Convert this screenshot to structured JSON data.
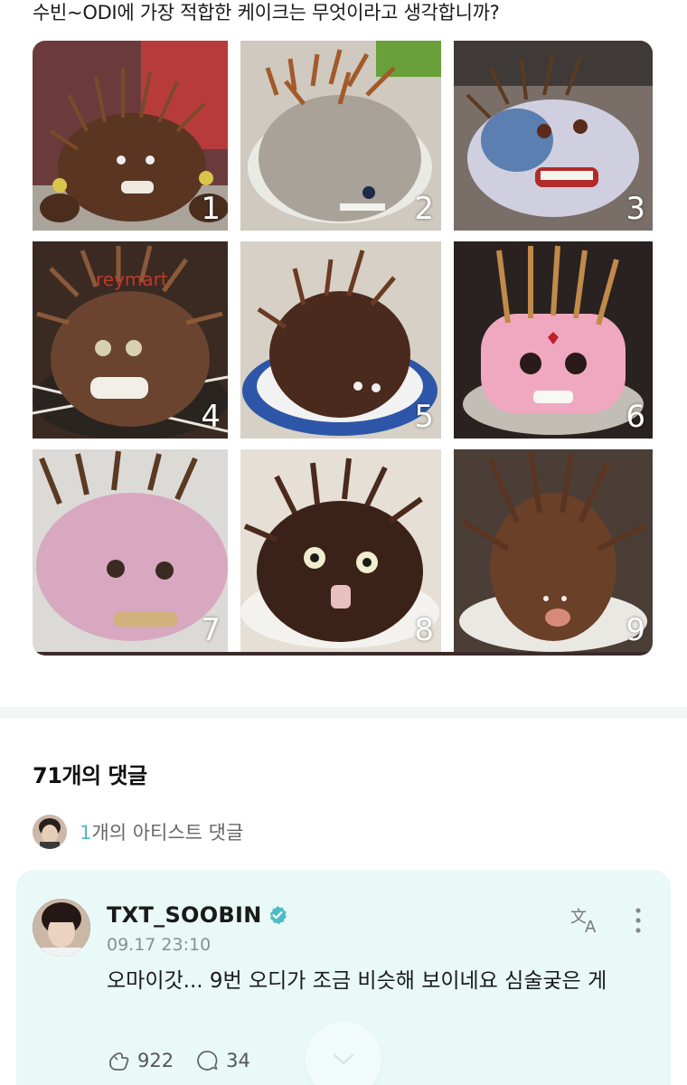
{
  "post": {
    "question": "수빈~ODI에 가장 적합한 케이크는 무엇이라고 생각합니까?",
    "images": [
      {
        "number": "1",
        "watermark": ""
      },
      {
        "number": "2",
        "watermark": ""
      },
      {
        "number": "3",
        "watermark": ""
      },
      {
        "number": "4",
        "watermark": "reymart"
      },
      {
        "number": "5",
        "watermark": ""
      },
      {
        "number": "6",
        "watermark": ""
      },
      {
        "number": "7",
        "watermark": ""
      },
      {
        "number": "8",
        "watermark": ""
      },
      {
        "number": "9",
        "watermark": ""
      }
    ]
  },
  "comments": {
    "count_label": "71개의 댓글",
    "artist_count": "1",
    "artist_label": "개의 아티스트 댓글",
    "items": [
      {
        "author": "TXT_SOOBIN",
        "verified": true,
        "time": "09.17 23:10",
        "body": "오마이갓... 9번 오디가 조금 비슷해 보이네요 심술궂은 게",
        "likes": "922",
        "replies": "34"
      }
    ]
  },
  "icons": {
    "verified": "verified-badge-icon",
    "translate": "translate-icon",
    "more": "more-vertical-icon",
    "like": "like-hand-icon",
    "reply": "reply-bubble-icon",
    "scroll": "chevron-down-icon"
  },
  "colors": {
    "accent": "#4dbcc4",
    "card_bg": "#e9f9f7",
    "divider_bg": "#f4f5f7"
  }
}
